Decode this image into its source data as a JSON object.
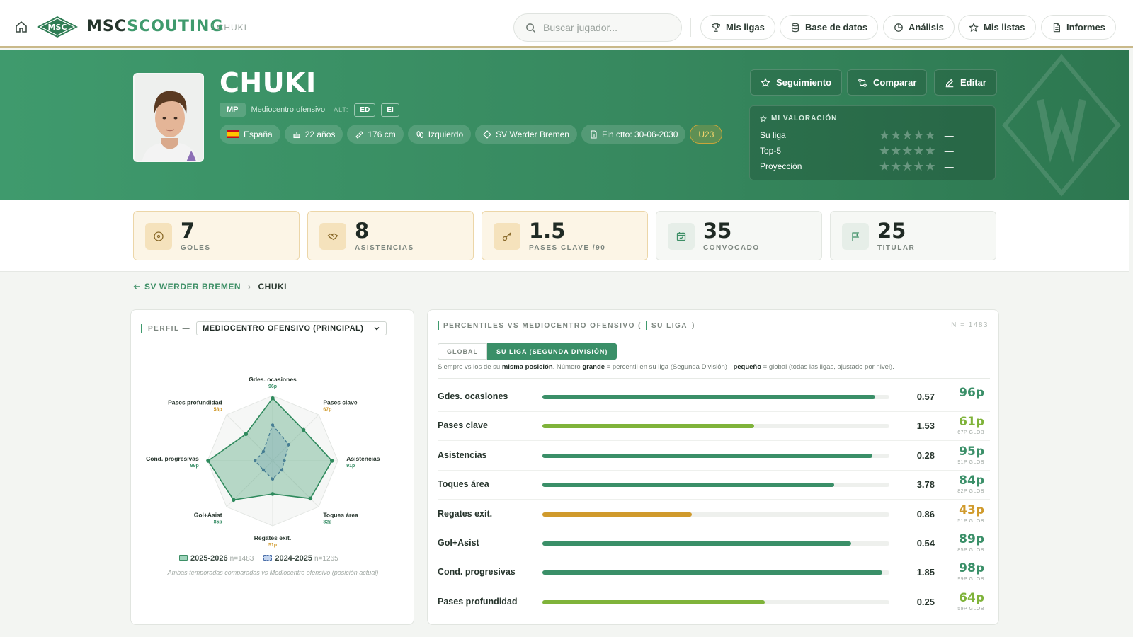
{
  "nav": {
    "brand_part1": "MSC",
    "brand_part2": "SCOUTING",
    "logo_text": "MSC",
    "crumb": "/ CHUKI",
    "search_placeholder": "Buscar jugador...",
    "buttons": [
      {
        "label": "Mis ligas",
        "icon": "trophy-icon"
      },
      {
        "label": "Base de datos",
        "icon": "database-icon"
      },
      {
        "label": "Análisis",
        "icon": "chart-icon"
      },
      {
        "label": "Mis listas",
        "icon": "star-icon"
      },
      {
        "label": "Informes",
        "icon": "document-icon"
      }
    ]
  },
  "player": {
    "name": "CHUKI",
    "position_code": "MP",
    "position_name": "Mediocentro ofensivo",
    "alt_label": "ALT:",
    "alt_positions": [
      "ED",
      "EI"
    ],
    "chips": {
      "country": "España",
      "age": "22 años",
      "height": "176 cm",
      "foot": "Izquierdo",
      "club": "SV Werder Bremen",
      "contract": "Fin ctto: 30-06-2030",
      "tag": "U23"
    }
  },
  "actions": {
    "follow": "Seguimiento",
    "compare": "Comparar",
    "edit": "Editar"
  },
  "rating": {
    "title": "MI VALORACIÓN",
    "rows": [
      {
        "label": "Su liga",
        "value": "—",
        "stars": "★★★★★"
      },
      {
        "label": "Top-5",
        "value": "—",
        "stars": "★★★★★"
      },
      {
        "label": "Proyección",
        "value": "—",
        "stars": "★★★★★"
      }
    ]
  },
  "stats": [
    {
      "value": "7",
      "label": "GOLES",
      "icon": "ball-icon"
    },
    {
      "value": "8",
      "label": "ASISTENCIAS",
      "icon": "handshake-icon"
    },
    {
      "value": "1.5",
      "label": "PASES CLAVE /90",
      "icon": "key-icon"
    },
    {
      "value": "35",
      "label": "CONVOCADO",
      "icon": "calendar-icon"
    },
    {
      "value": "25",
      "label": "TITULAR",
      "icon": "flag-icon"
    }
  ],
  "breadcrumb": {
    "parent": "SV WERDER BREMEN",
    "current": "CHUKI"
  },
  "profile": {
    "label": "PERFIL —",
    "selected": "MEDIOCENTRO OFENSIVO (PRINCIPAL)",
    "radar": {
      "axes": [
        {
          "label": "Gdes. ocasiones",
          "pct": "96p",
          "current": 96,
          "previous": 55
        },
        {
          "label": "Pases clave",
          "pct": "67p",
          "current": 67,
          "previous": 35
        },
        {
          "label": "Asistencias",
          "pct": "91p",
          "current": 91,
          "previous": 18
        },
        {
          "label": "Toques área",
          "pct": "82p",
          "current": 82,
          "previous": 20
        },
        {
          "label": "Regates exit.",
          "pct": "51p",
          "current": 51,
          "previous": 28
        },
        {
          "label": "Gol+Asist",
          "pct": "85p",
          "current": 85,
          "previous": 20
        },
        {
          "label": "Cond. progresivas",
          "pct": "99p",
          "current": 99,
          "previous": 27
        },
        {
          "label": "Pases profundidad",
          "pct": "58p",
          "current": 58,
          "previous": 20
        }
      ]
    },
    "legend": [
      {
        "season": "2025-2026",
        "n": "n=1483"
      },
      {
        "season": "2024-2025",
        "n": "n=1265"
      }
    ],
    "note": "Ambas temporadas comparadas vs Mediocentro ofensivo (posición actual)"
  },
  "percentiles": {
    "title_part1": "PERCENTILES VS MEDIOCENTRO OFENSIVO (",
    "title_part2": "SU LIGA",
    "title_part3": ")",
    "n": "N = 1483",
    "tabs": [
      "GLOBAL",
      "SU LIGA (SEGUNDA DIVISIÓN)"
    ],
    "note_parts": [
      "Siempre vs los de su ",
      "misma posición",
      ". Número ",
      "grande",
      " = percentil en su liga (Segunda División) · ",
      "pequeño",
      " = global (todas las ligas, ajustado por nivel)."
    ],
    "rows": [
      {
        "name": "Gdes. ocasiones",
        "value": "0.57",
        "pct_label": "96p",
        "glob": "",
        "pct": 96,
        "color": "#3a8f68"
      },
      {
        "name": "Pases clave",
        "value": "1.53",
        "pct_label": "61p",
        "glob": "67P GLOB",
        "pct": 61,
        "color": "#7fb33a"
      },
      {
        "name": "Asistencias",
        "value": "0.28",
        "pct_label": "95p",
        "glob": "91P GLOB",
        "pct": 95,
        "color": "#3a8f68"
      },
      {
        "name": "Toques área",
        "value": "3.78",
        "pct_label": "84p",
        "glob": "82P GLOB",
        "pct": 84,
        "color": "#3a8f68"
      },
      {
        "name": "Regates exit.",
        "value": "0.86",
        "pct_label": "43p",
        "glob": "51P GLOB",
        "pct": 43,
        "color": "#d09a2c"
      },
      {
        "name": "Gol+Asist",
        "value": "0.54",
        "pct_label": "89p",
        "glob": "85P GLOB",
        "pct": 89,
        "color": "#3a8f68"
      },
      {
        "name": "Cond. progresivas",
        "value": "1.85",
        "pct_label": "98p",
        "glob": "99P GLOB",
        "pct": 98,
        "color": "#3a8f68"
      },
      {
        "name": "Pases profundidad",
        "value": "0.25",
        "pct_label": "64p",
        "glob": "59P GLOB",
        "pct": 64,
        "color": "#7fb33a"
      }
    ]
  }
}
